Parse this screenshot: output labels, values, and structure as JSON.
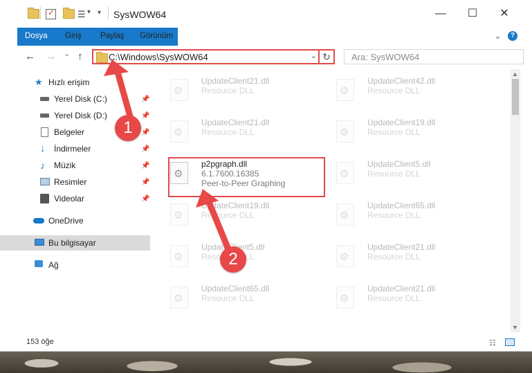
{
  "window": {
    "title": "SysWOW64",
    "minimize_glyph": "—",
    "maximize_glyph": "☐",
    "close_glyph": "✕"
  },
  "ribbon": {
    "tabs": [
      {
        "label": "Dosya"
      },
      {
        "label": "Giriş"
      },
      {
        "label": "Paylaş"
      },
      {
        "label": "Görünüm"
      }
    ],
    "collapse_glyph": "⌄",
    "help_glyph": "?"
  },
  "nav": {
    "back_glyph": "←",
    "forward_glyph": "→",
    "recent_glyph": "⌄",
    "up_glyph": "↑"
  },
  "address": {
    "path": "C:\\Windows\\SysWOW64",
    "dropdown_glyph": "⌄",
    "refresh_glyph": "↻"
  },
  "search": {
    "placeholder": "Ara: SysWOW64"
  },
  "sidebar": {
    "items": [
      {
        "label": "Hızlı erişim",
        "icon": "star-icon"
      },
      {
        "label": "Yerel Disk (C:)",
        "icon": "drive-icon"
      },
      {
        "label": "Yerel Disk (D:)",
        "icon": "drive-icon"
      },
      {
        "label": "Belgeler",
        "icon": "documents-icon"
      },
      {
        "label": "İndirmeler",
        "icon": "download-icon"
      },
      {
        "label": "Müzik",
        "icon": "music-icon"
      },
      {
        "label": "Resimler",
        "icon": "pictures-icon"
      },
      {
        "label": "Videolar",
        "icon": "videos-icon"
      },
      {
        "label": "OneDrive",
        "icon": "cloud-icon"
      },
      {
        "label": "Bu bilgisayar",
        "icon": "computer-icon"
      },
      {
        "label": "Ağ",
        "icon": "network-icon"
      }
    ],
    "pin_glyph": "📌"
  },
  "files": [
    {
      "name": "UpdateClient21.dll",
      "type": "Resource DLL"
    },
    {
      "name": "UpdateClient42.dll",
      "type": "Resource DLL"
    },
    {
      "name": "UpdateClient21.dll",
      "type": "Resource DLL"
    },
    {
      "name": "UpdateClient19.dll",
      "type": "Resource DLL"
    },
    {
      "name": "p2pgraph.dll",
      "version": "6.1.7600.16385",
      "type": "Peer-to-Peer Graphing"
    },
    {
      "name": "UpdateClient5.dll",
      "type": "Resource DLL"
    },
    {
      "name": "UpdateClient19.dll",
      "type": "Resource DLL"
    },
    {
      "name": "UpdateClient65.dll",
      "type": "Resource DLL"
    },
    {
      "name": "UpdateClient5.dll",
      "type": "Resource DLL"
    },
    {
      "name": "UpdateClient21.dll",
      "type": "Resource DLL"
    },
    {
      "name": "UpdateClient65.dll",
      "type": "Resource DLL"
    },
    {
      "name": "UpdateClient21.dll",
      "type": "Resource DLL"
    }
  ],
  "status": {
    "count": "153 öğe"
  },
  "annotations": {
    "step1": "1",
    "step2": "2",
    "accent_color": "#e04a4a"
  }
}
